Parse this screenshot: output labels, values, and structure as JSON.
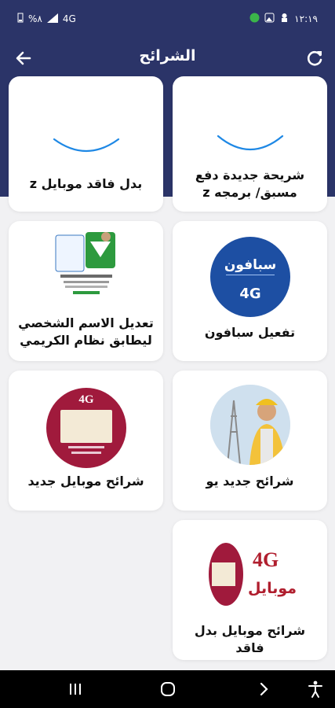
{
  "status_bar": {
    "time": "١٢:١٩",
    "battery": "%٨",
    "signal": "4G"
  },
  "app_bar": {
    "title": "الشرائح"
  },
  "cards": [
    {
      "label": "شريحة جديدة دفع مسبق/ برمجه z",
      "image": "loading-spinner"
    },
    {
      "label": "بدل فاقد موبايل z",
      "image": "loading-spinner"
    },
    {
      "label": "تفعيل سبافون",
      "image": "sabafon-4g-logo",
      "logo_text": "سبافون",
      "badge": "4G"
    },
    {
      "label": "تعديل الاسم الشخصي ليطابق نظام الكريمي",
      "image": "kuraimi-promo"
    },
    {
      "label": "شرائح جديد يو",
      "image": "engineer-tower-photo"
    },
    {
      "label": "شرائح موبايل جديد",
      "image": "mobile-4g-logo",
      "badge": "4G"
    },
    {
      "label": "شرائح موبايل بدل فاقد",
      "image": "mobile-4g-lost-logo",
      "badge": "4G",
      "badge_text": "موبايل"
    }
  ],
  "colors": {
    "primary": "#2b3468",
    "sabafon_blue": "#1d4fa3",
    "mobile_red": "#a01a3c"
  }
}
